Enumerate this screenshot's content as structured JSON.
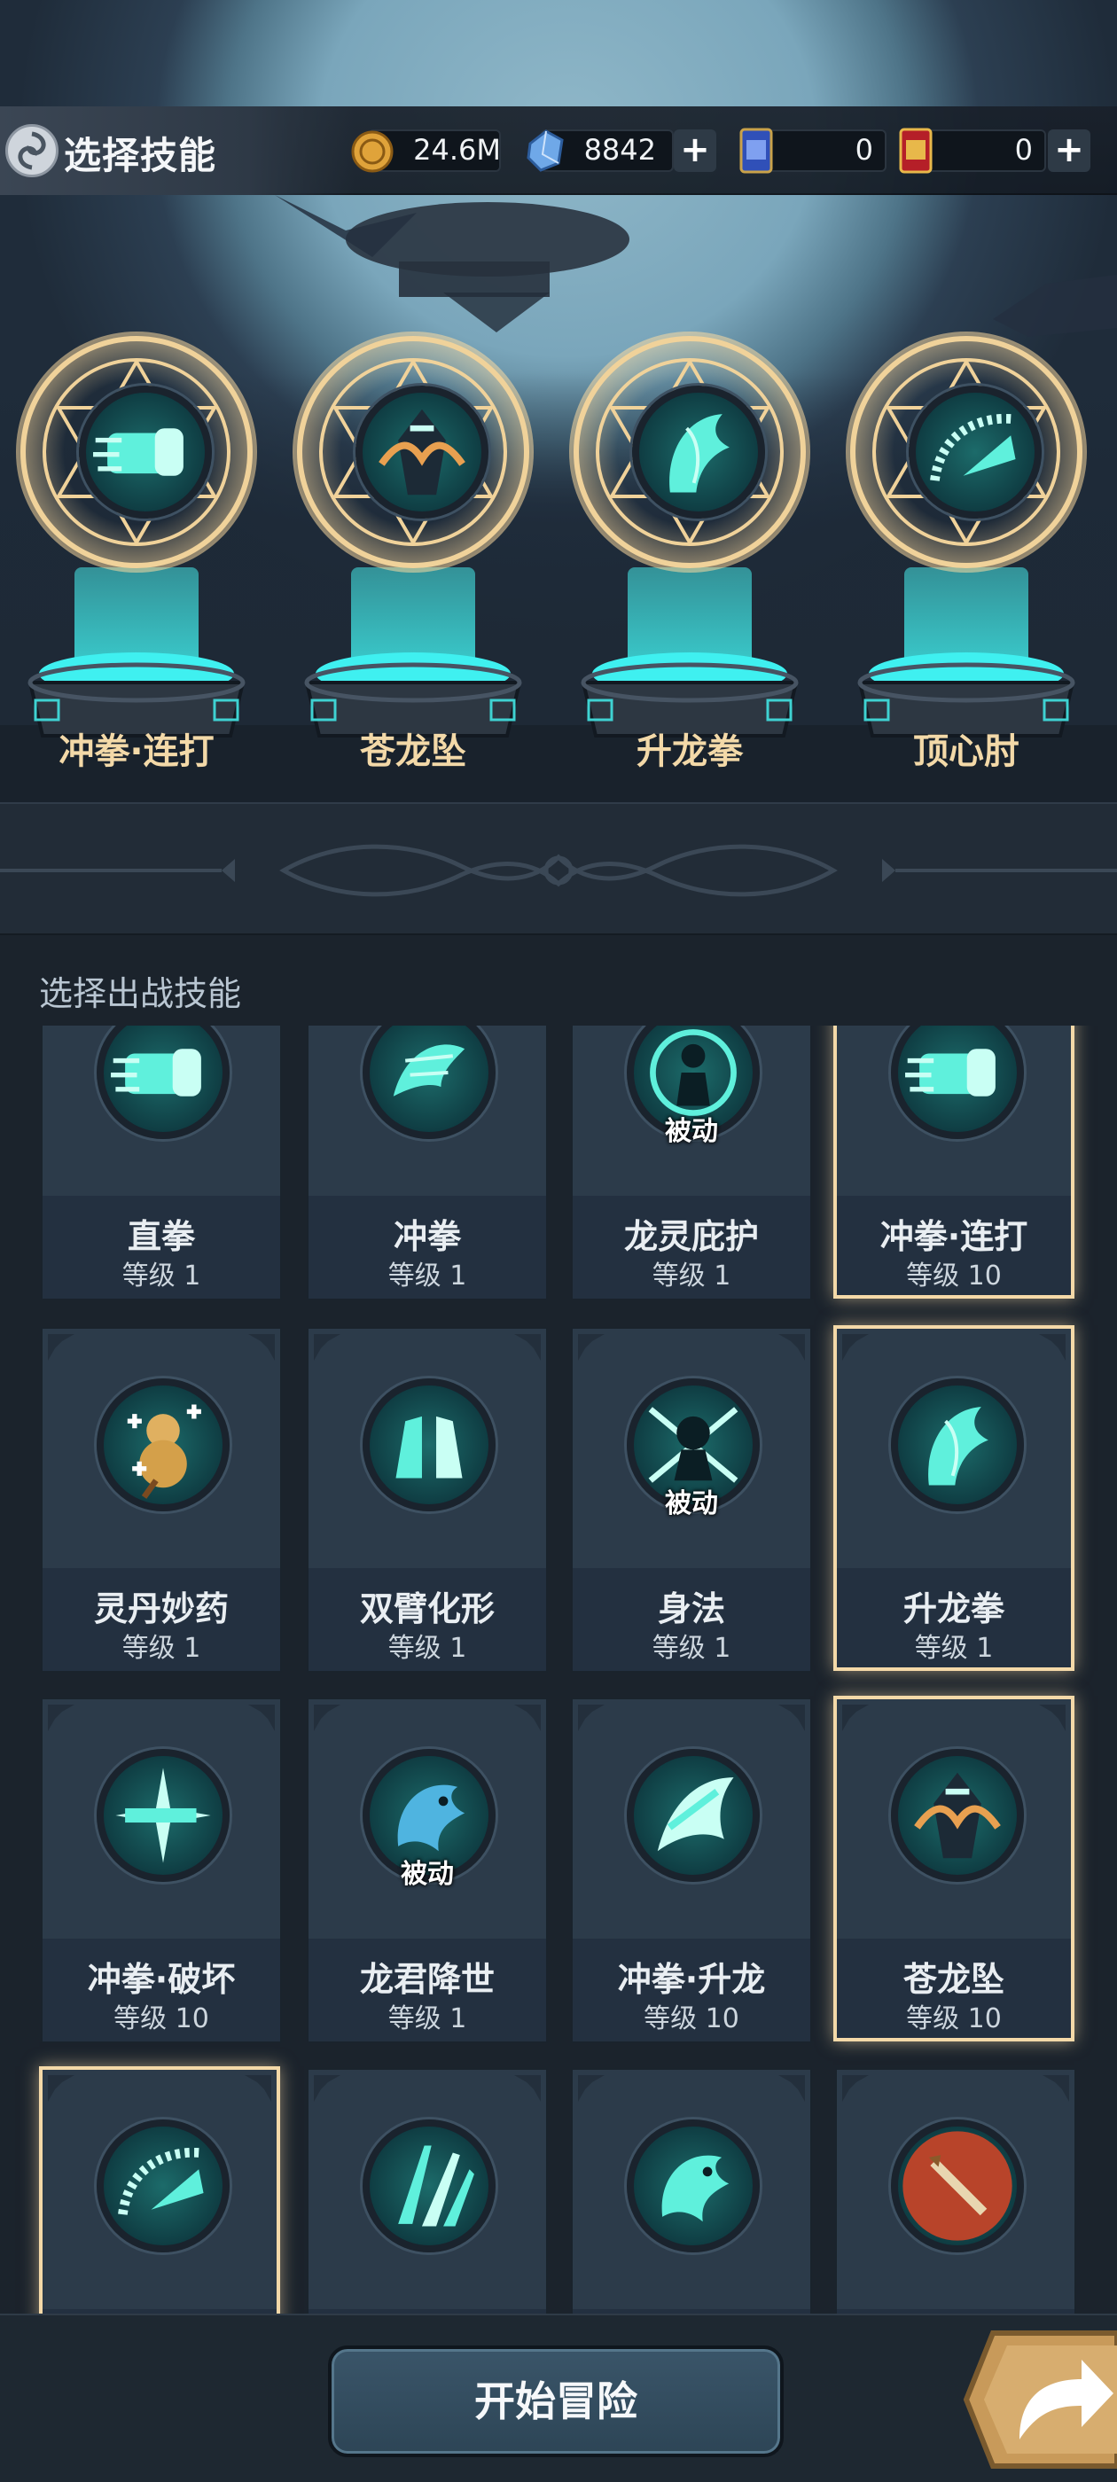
{
  "header": {
    "title": "选择技能",
    "resources": [
      {
        "icon": "gold-coin-icon",
        "value": "24.6M",
        "has_plus": false
      },
      {
        "icon": "crystal-icon",
        "value": "8842",
        "has_plus": true
      },
      {
        "icon": "blue-ticket-icon",
        "value": "0",
        "has_plus": false
      },
      {
        "icon": "gold-ticket-icon",
        "value": "0",
        "has_plus": true
      }
    ]
  },
  "equipped": [
    {
      "label": "冲拳·连打",
      "icon": "fist-combo-icon"
    },
    {
      "label": "苍龙坠",
      "icon": "azure-dragon-icon"
    },
    {
      "label": "升龙拳",
      "icon": "rising-dragon-icon"
    },
    {
      "label": "顶心肘",
      "icon": "elbow-strike-icon"
    }
  ],
  "list": {
    "title": "选择出战技能",
    "level_prefix": "等级",
    "passive_label": "被动",
    "skills": [
      {
        "name": "直拳",
        "level": "等级 1",
        "passive": false,
        "selected": false,
        "icon": "fist-icon"
      },
      {
        "name": "冲拳",
        "level": "等级 1",
        "passive": false,
        "selected": false,
        "icon": "dragon-fist-icon"
      },
      {
        "name": "龙灵庇护",
        "level": "等级 1",
        "passive": true,
        "selected": false,
        "icon": "spirit-guard-icon"
      },
      {
        "name": "冲拳·连打",
        "level": "等级 10",
        "passive": false,
        "selected": true,
        "icon": "fist-combo-icon"
      },
      {
        "name": "灵丹妙药",
        "level": "等级 1",
        "passive": false,
        "selected": false,
        "icon": "gourd-icon"
      },
      {
        "name": "双臂化形",
        "level": "等级 1",
        "passive": false,
        "selected": false,
        "icon": "twin-arms-icon"
      },
      {
        "name": "身法",
        "level": "等级 1",
        "passive": true,
        "selected": false,
        "icon": "body-technique-icon"
      },
      {
        "name": "升龙拳",
        "level": "等级 1",
        "passive": false,
        "selected": true,
        "icon": "rising-dragon-icon"
      },
      {
        "name": "冲拳·破坏",
        "level": "等级 10",
        "passive": false,
        "selected": false,
        "icon": "fist-break-icon"
      },
      {
        "name": "龙君降世",
        "level": "等级 1",
        "passive": true,
        "selected": false,
        "icon": "dragon-lord-icon"
      },
      {
        "name": "冲拳·升龙",
        "level": "等级 10",
        "passive": false,
        "selected": false,
        "icon": "fist-rising-icon"
      },
      {
        "name": "苍龙坠",
        "level": "等级 10",
        "passive": false,
        "selected": true,
        "icon": "azure-dragon-icon"
      },
      {
        "name": "",
        "level": "",
        "passive": false,
        "selected": true,
        "icon": "elbow-strike-icon"
      },
      {
        "name": "",
        "level": "",
        "passive": false,
        "selected": false,
        "icon": "claw-slash-icon"
      },
      {
        "name": "",
        "level": "",
        "passive": false,
        "selected": false,
        "icon": "water-dragon-icon"
      },
      {
        "name": "",
        "level": "",
        "passive": false,
        "selected": false,
        "icon": "flame-sword-icon"
      }
    ]
  },
  "footer": {
    "start_label": "开始冒险",
    "share_icon": "share-arrow-icon"
  },
  "colors": {
    "accent_gold": "#f4d9a8",
    "teal_glow": "#46e6e6",
    "card_bg": "#2a3846",
    "button_bg": "#2d4556"
  }
}
